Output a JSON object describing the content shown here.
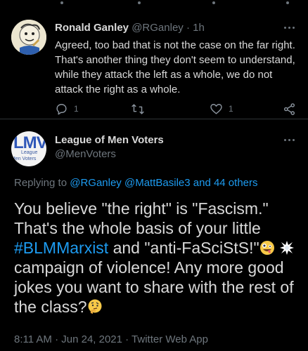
{
  "reply_tweet": {
    "author_name": "Ronald Ganley",
    "handle": "@RGanley",
    "separator": " · ",
    "time": "1h",
    "text": "Agreed, too bad that is not the case on the far right. That's another thing they don't seem to understand, while they attack the left as a whole, we do not attack the right as a whole.",
    "reply_count": "1",
    "like_count": "1"
  },
  "main_tweet": {
    "author_name": "League of Men Voters",
    "handle": "@MenVoters",
    "avatar_text_big": "LMV",
    "avatar_text_line1": "League",
    "avatar_text_line2": "Men Voters",
    "replying_prefix": "Replying to ",
    "replying_user1": "@RGanley",
    "replying_user2": "@MattBasile3",
    "replying_suffix": "and 44 others",
    "text_part1": "You believe \"the right\" is \"Fascism.\" That's the whole basis of your little ",
    "hashtag": "#BLMMarxist",
    "text_part2": " and \"anti-FaSciStS!\"",
    "text_part3": " campaign of violence!  Any more good jokes you want to share with the rest of the class?",
    "timestamp": "8:11 AM · Jun 24, 2021 · Twitter Web App"
  },
  "icons": {
    "reply": "reply-bubble-icon",
    "retweet": "retweet-icon",
    "like": "heart-icon",
    "share": "share-icon",
    "more": "more-dots-icon",
    "emoji1": "zany-face-emoji",
    "emoji2": "collision-emoji",
    "emoji3": "thinking-face-emoji"
  },
  "colors": {
    "background": "#000000",
    "text": "#d9d9d9",
    "muted": "#6e767d",
    "link": "#1d9bf0",
    "divider": "#2f3336"
  }
}
